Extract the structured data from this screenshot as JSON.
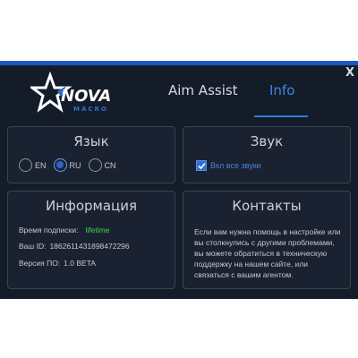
{
  "window": {
    "close_label": "X"
  },
  "logo": {
    "brand": "NOVA",
    "sub": "MACRO"
  },
  "tabs": [
    {
      "label": "Aim Assist"
    },
    {
      "label": "Info"
    }
  ],
  "language": {
    "title": "Язык",
    "options": [
      {
        "label": "EN"
      },
      {
        "label": "RU"
      },
      {
        "label": "CN"
      }
    ],
    "selected": "RU"
  },
  "sound": {
    "title": "Звук",
    "checkbox_label": "Вкл все звуки",
    "checked": true
  },
  "info": {
    "title": "Информация",
    "subscription_label": "Время подписки:",
    "subscription_value": "lifetime",
    "id_label": "Ваш ID:",
    "id_value": "1862611431898472296",
    "version_label": "Версия ПО:",
    "version_value": "1.0 BETA"
  },
  "contacts": {
    "title": "Контакты",
    "text": "Если вам нужна помощь в настройке или вы столкнулись с другими проблемами, вы можете обратиться в техническую поддержку на нашем сайте, или связаться с вашим агентом."
  },
  "colors": {
    "background": "#151c29",
    "accent": "#2f7ae0",
    "lifetime": "#3fd24c"
  }
}
